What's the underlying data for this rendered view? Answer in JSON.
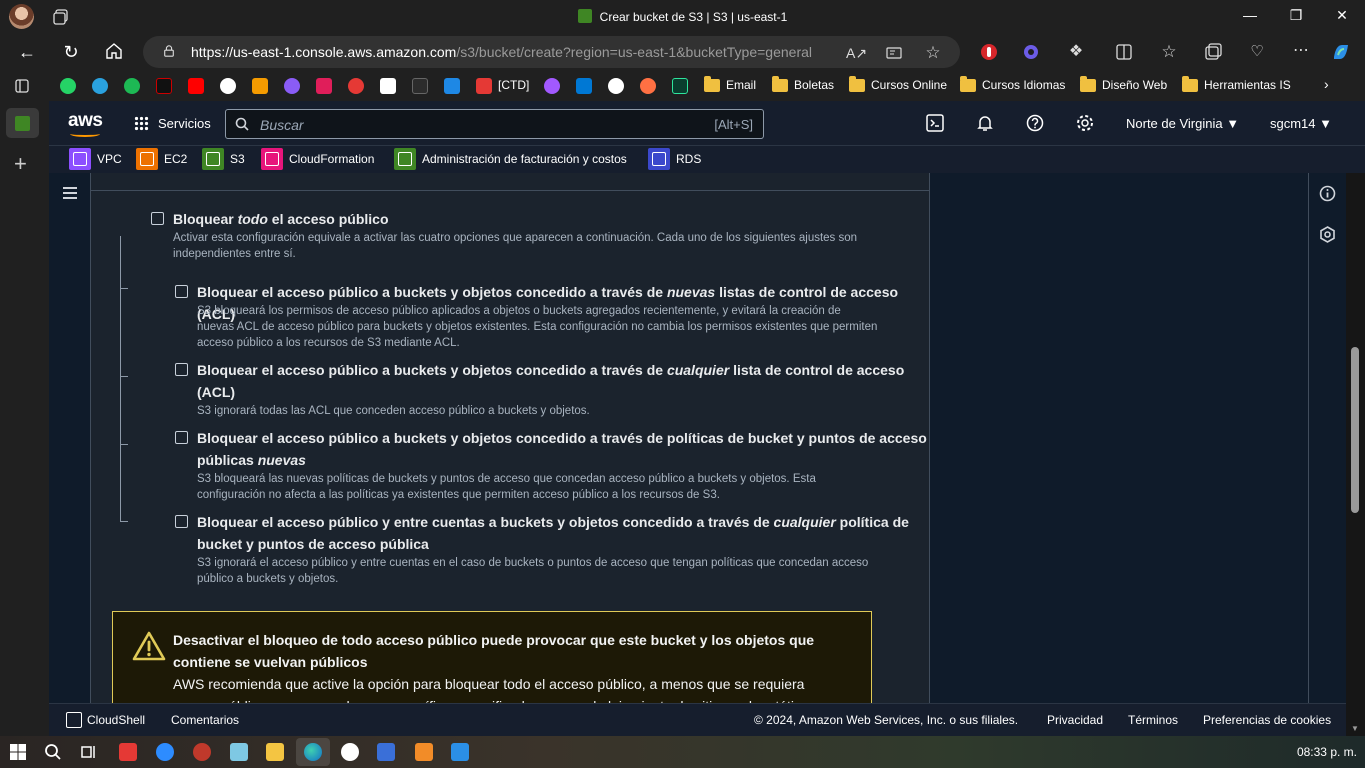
{
  "browser": {
    "title": "Crear bucket de S3 | S3 | us-east-1",
    "url_host": "https://us-east-1.console.aws.amazon.com",
    "url_path": "/s3/bucket/create?region=us-east-1&bucketType=general"
  },
  "bookmarks": [
    "[CTD]",
    "Email",
    "Boletas",
    "Cursos Online",
    "Cursos Idiomas",
    "Diseño Web",
    "Herramientas IS"
  ],
  "aws_header": {
    "logo": "aws",
    "services": "Servicios",
    "search_placeholder": "Buscar",
    "search_shortcut": "[Alt+S]",
    "region": "Norte de Virginia ▼",
    "user": "sgcm14 ▼"
  },
  "favorites": [
    "VPC",
    "EC2",
    "S3",
    "CloudFormation",
    "Administración de facturación y costos",
    "RDS"
  ],
  "block_all": {
    "title_pre": "Bloquear ",
    "title_em": "todo",
    "title_post": " el acceso público",
    "desc_1": "Activar esta configuración equivale a activar las cuatro opciones que aparecen a continuación. Cada uno de los siguientes ajustes son",
    "desc_2": "independientes entre sí."
  },
  "options": [
    {
      "title_pre": "Bloquear el acceso público a buckets y objetos concedido a través de ",
      "title_em": "nuevas",
      "title_post": " listas de control de acceso (ACL)",
      "desc": [
        "S3 bloqueará los permisos de acceso público aplicados a objetos o buckets agregados recientemente, y evitará la creación de",
        "nuevas ACL de acceso público para buckets y objetos existentes. Esta configuración no cambia los permisos existentes que permiten",
        "acceso público a los recursos de S3 mediante ACL."
      ]
    },
    {
      "title_pre": "Bloquear el acceso público a buckets y objetos concedido a través de ",
      "title_em": "cualquier",
      "title_post": " lista de control de acceso",
      "title_line2": "(ACL)",
      "desc": [
        "S3 ignorará todas las ACL que conceden acceso público a buckets y objetos."
      ]
    },
    {
      "title_pre": "Bloquear el acceso público a buckets y objetos concedido a través de políticas de bucket y puntos de acceso",
      "title_line2_pre": "públicas ",
      "title_line2_em": "nuevas",
      "desc": [
        "S3 bloqueará las nuevas políticas de buckets y puntos de acceso que concedan acceso público a buckets y objetos. Esta",
        "configuración no afecta a las políticas ya existentes que permiten acceso público a los recursos de S3."
      ]
    },
    {
      "title_pre": "Bloquear el acceso público y entre cuentas a buckets y objetos concedido a través de ",
      "title_em": "cualquier",
      "title_post": " política de",
      "title_line2": "bucket y puntos de acceso pública",
      "desc": [
        "S3 ignorará el acceso público y entre cuentas en el caso de buckets o puntos de acceso que tengan políticas que concedan acceso",
        "público a buckets y objetos."
      ]
    }
  ],
  "warning": {
    "title_1": "Desactivar el bloqueo de todo acceso público puede provocar que este bucket y los objetos que",
    "title_2": "contiene se vuelvan públicos",
    "body_1": "AWS recomienda que active la opción para bloquear todo el acceso público, a menos que se requiera",
    "body_2": "acceso público para casos de uso específicos y verificados, como el alojamiento de sitios web estáticos."
  },
  "footer": {
    "cloudshell": "CloudShell",
    "comentarios": "Comentarios",
    "copyright": "© 2024, Amazon Web Services, Inc. o sus filiales.",
    "privacidad": "Privacidad",
    "terminos": "Términos",
    "cookies": "Preferencias de cookies"
  },
  "taskbar": {
    "clock": "08:33 p. m."
  },
  "colors": {
    "aws_header": "#161e2d",
    "aws_orange": "#ff9900",
    "s3_green": "#3f8624",
    "warning_border": "#e0ca57"
  }
}
